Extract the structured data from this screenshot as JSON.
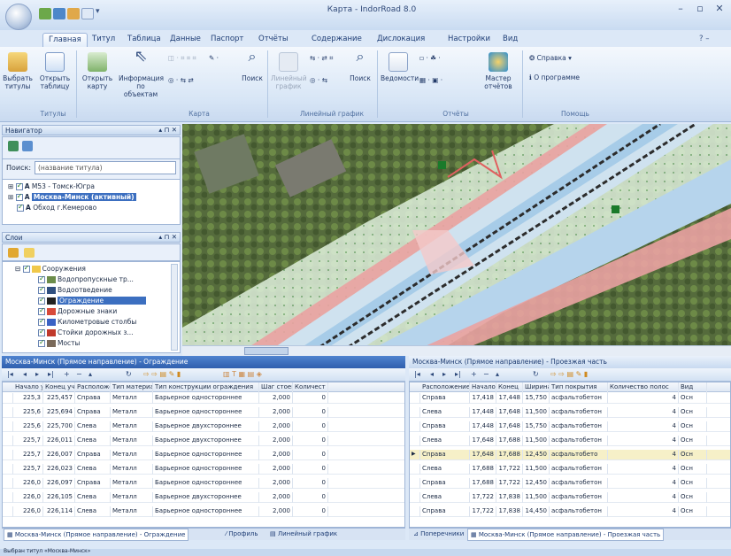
{
  "window": {
    "title": "Карта - IndorRoad 8.0",
    "controls": [
      "–",
      "▫",
      "✕"
    ]
  },
  "qat": [
    "qat-save",
    "qat-open",
    "qat-table",
    "qat-window",
    "qat-more"
  ],
  "tabs": [
    "Главная",
    "Титул",
    "Таблица",
    "Данные",
    "Паспорт",
    "Отчёты",
    "Содержание",
    "Дислокация",
    "Настройки",
    "Вид"
  ],
  "ribbon": {
    "buttons": {
      "select_titles": "Выбрать титулы",
      "open_table": "Открыть таблицу",
      "open_map": "Открыть карту",
      "info": "Информация по объектам",
      "search_map": "Поиск",
      "linear": "Линейный график",
      "search_linear": "Поиск",
      "statements": "Ведомости",
      "wizard": "Мастер отчётов",
      "help": "Справка",
      "about": "О программе"
    },
    "groups": [
      "Титулы",
      "Карта",
      "Линейный график",
      "Отчёты",
      "Помощь"
    ]
  },
  "navigator": {
    "title": "Навигатор",
    "search_label": "Поиск:",
    "search_value": "(название титула)",
    "items": [
      "М53 - Томск-Югра",
      "Москва-Минск (активный)",
      "Обход г.Кемерово"
    ]
  },
  "layers": {
    "title": "Слои",
    "items": [
      "Сооружения",
      "Водопропускные тр...",
      "Водоотведение",
      "Ограждение",
      "Дорожные знаки",
      "Километровые столбы",
      "Стойки дорожных з...",
      "Мосты"
    ]
  },
  "grid_left": {
    "title": "Москва-Минск (Прямое направление) - Ограждение",
    "headers": [
      "Начало уч",
      "Конец уч",
      "Расположение",
      "Тип материала",
      "Тип конструкции ограждения",
      "Шаг стоек",
      "Количест"
    ],
    "rows": [
      [
        "225,3",
        "225,457",
        "Справа",
        "Металл",
        "Барьерное одностороннее",
        "2,000",
        "0"
      ],
      [
        "225,6",
        "225,694",
        "Справа",
        "Металл",
        "Барьерное одностороннее",
        "2,000",
        "0"
      ],
      [
        "225,6",
        "225,700",
        "Слева",
        "Металл",
        "Барьерное двухстороннее",
        "2,000",
        "0"
      ],
      [
        "225,7",
        "226,011",
        "Слева",
        "Металл",
        "Барьерное двухстороннее",
        "2,000",
        "0"
      ],
      [
        "225,7",
        "226,007",
        "Справа",
        "Металл",
        "Барьерное одностороннее",
        "2,000",
        "0"
      ],
      [
        "225,7",
        "226,023",
        "Слева",
        "Металл",
        "Барьерное одностороннее",
        "2,000",
        "0"
      ],
      [
        "226,0",
        "226,097",
        "Справа",
        "Металл",
        "Барьерное одностороннее",
        "2,000",
        "0"
      ],
      [
        "226,0",
        "226,105",
        "Слева",
        "Металл",
        "Барьерное двухстороннее",
        "2,000",
        "0"
      ],
      [
        "226,0",
        "226,114",
        "Слева",
        "Металл",
        "Барьерное одностороннее",
        "2,000",
        "0"
      ]
    ]
  },
  "grid_right": {
    "title": "Москва-Минск (Прямое направление) - Проезжая часть",
    "headers": [
      "Расположение",
      "Начало",
      "Конец",
      "Ширина",
      "Тип покрытия",
      "Количество полос",
      "Вид"
    ],
    "rows": [
      [
        "Справа",
        "17,418",
        "17,448",
        "15,750",
        "асфальтобетон",
        "4",
        "Осн"
      ],
      [
        "Слева",
        "17,448",
        "17,648",
        "11,500",
        "асфальтобетон",
        "4",
        "Осн"
      ],
      [
        "Справа",
        "17,448",
        "17,648",
        "15,750",
        "асфальтобетон",
        "4",
        "Осн"
      ],
      [
        "Слева",
        "17,648",
        "17,688",
        "11,500",
        "асфальтобетон",
        "4",
        "Осн"
      ],
      [
        "Справа",
        "17,648",
        "17,688",
        "12,450",
        "асфальтобето",
        "4",
        "Осн"
      ],
      [
        "Слева",
        "17,688",
        "17,722",
        "11,500",
        "асфальтобетон",
        "4",
        "Осн"
      ],
      [
        "Справа",
        "17,688",
        "17,722",
        "12,450",
        "асфальтобетон",
        "4",
        "Осн"
      ],
      [
        "Слева",
        "17,722",
        "17,838",
        "11,500",
        "асфальтобетон",
        "4",
        "Осн"
      ],
      [
        "Справа",
        "17,722",
        "17,838",
        "14,450",
        "асфальтобетон",
        "4",
        "Осн"
      ]
    ]
  },
  "bottom_tabs_left": [
    "Москва-Минск (Прямое направление) - Ограждение",
    "Профиль",
    "Линейный график"
  ],
  "bottom_tabs_right": [
    "Поперечники",
    "Москва-Минск (Прямое направление) - Проезжая часть"
  ],
  "status": "Выбран титул «Москва-Минск»",
  "colors": {
    "accent": "#3f76c3",
    "selection": "#3c6fc0",
    "road_pink": "#f2a5a5",
    "road_blue": "#a7cce8"
  }
}
